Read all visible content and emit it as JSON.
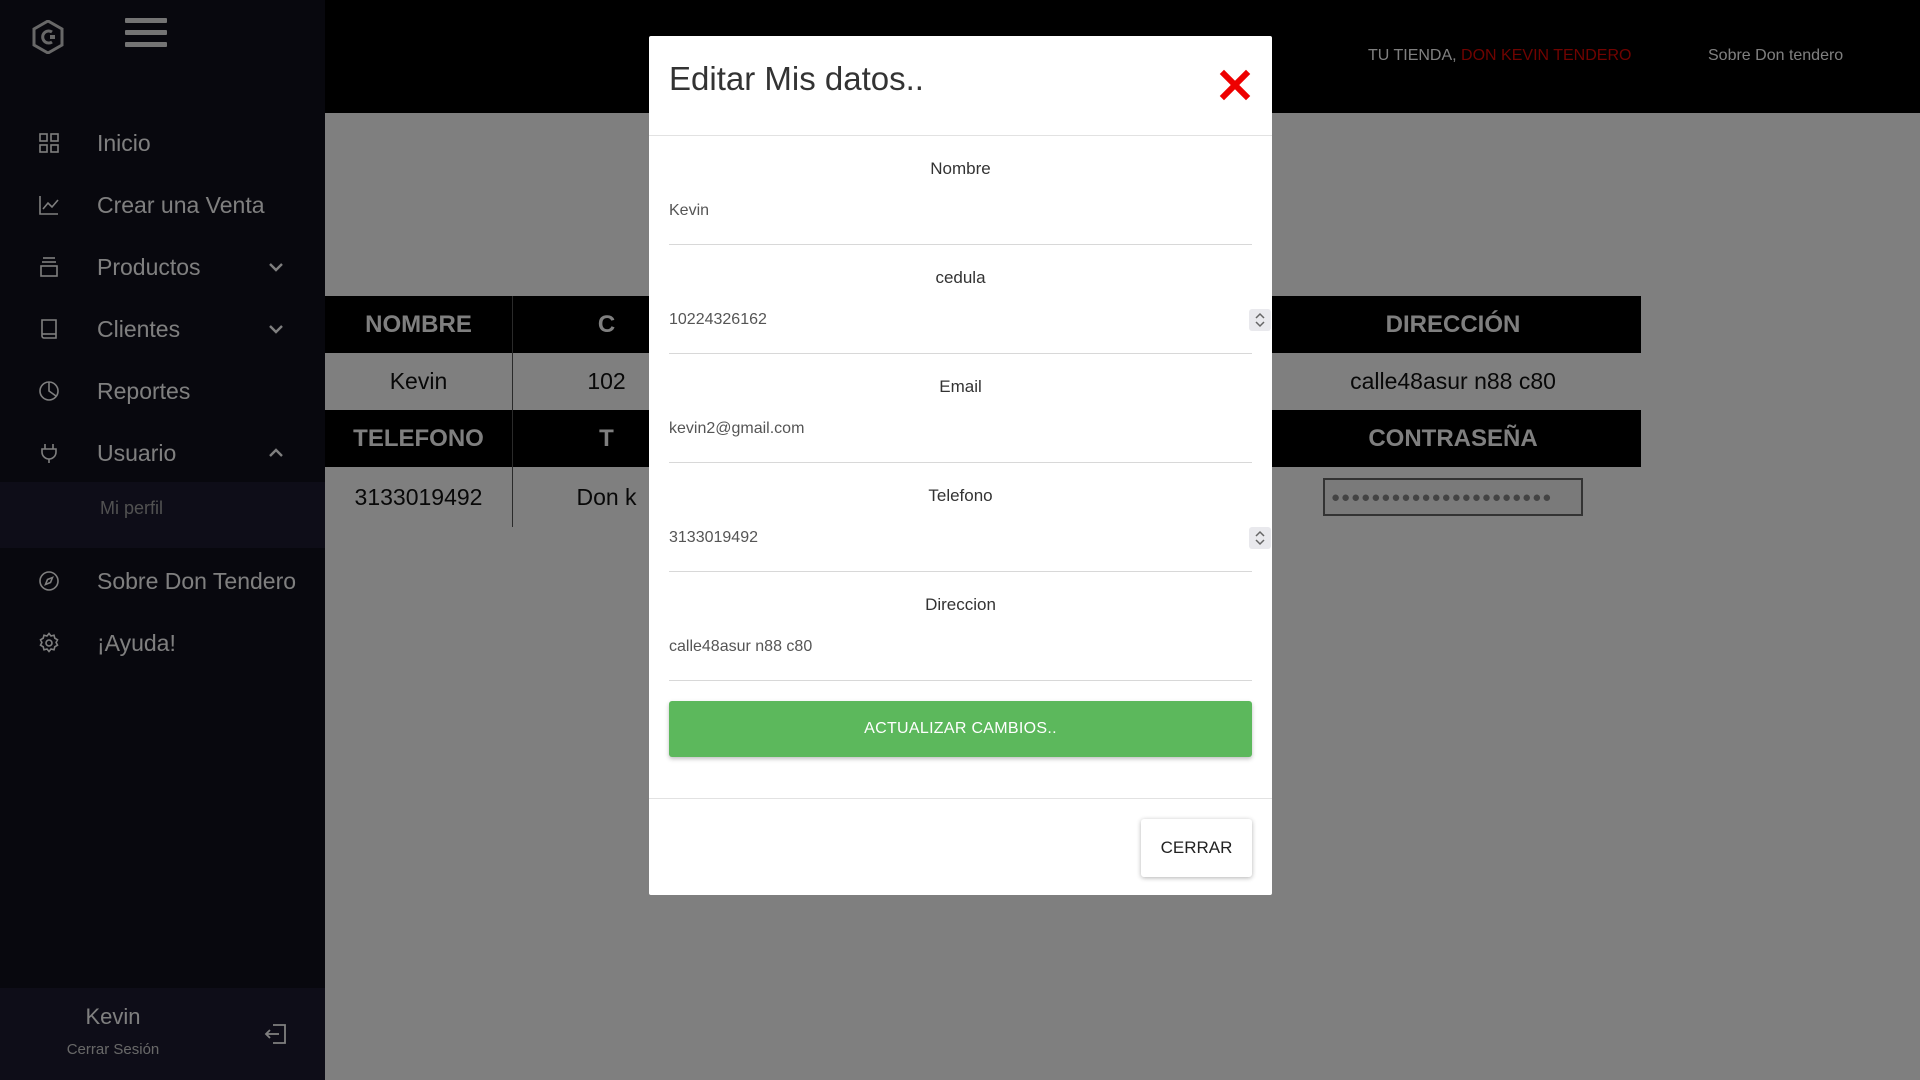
{
  "sidebar": {
    "items": [
      {
        "label": "Inicio",
        "icon": "grid-icon"
      },
      {
        "label": "Crear una Venta",
        "icon": "chart-line-icon"
      },
      {
        "label": "Productos",
        "icon": "stack-icon"
      },
      {
        "label": "Clientes",
        "icon": "book-icon"
      },
      {
        "label": "Reportes",
        "icon": "pie-chart-icon"
      },
      {
        "label": "Usuario",
        "icon": "plug-icon"
      },
      {
        "label": "Sobre Don Tendero",
        "icon": "compass-icon"
      },
      {
        "label": "¡Ayuda!",
        "icon": "gear-icon"
      }
    ],
    "submenu": {
      "label": "Mi perfil"
    },
    "profile": {
      "name": "Kevin",
      "logout_label": "Cerrar Sesión"
    }
  },
  "header": {
    "brand_prefix": "TU TIENDA, ",
    "brand_store": "DON KEVIN TENDERO",
    "about_link": "Sobre Don tendero"
  },
  "table": {
    "headers_row1": [
      "NOMBRE",
      "C",
      "",
      "",
      "",
      "DIRECCIÓN"
    ],
    "values_row1": [
      "Kevin",
      "102",
      "",
      "",
      "",
      "calle48asur n88 c80"
    ],
    "headers_row2": [
      "TELEFONO",
      "T",
      "",
      "",
      "",
      "CONTRASEÑA"
    ],
    "values_row2": [
      "3133019492",
      "Don k",
      "",
      "",
      "",
      ""
    ],
    "password_mask": "●●●●●●●●●●●●●●●●●●●●●●"
  },
  "modal": {
    "title": "Editar Mis datos..",
    "fields": [
      {
        "label": "Nombre",
        "value": "Kevin"
      },
      {
        "label": "cedula",
        "value": "10224326162"
      },
      {
        "label": "Email",
        "value": "kevin2@gmail.com"
      },
      {
        "label": "Telefono",
        "value": "3133019492"
      },
      {
        "label": "Direccion",
        "value": "calle48asur n88 c80"
      }
    ],
    "update_button": "ACTUALIZAR CAMBIOS..",
    "close_button": "CERRAR"
  },
  "colors": {
    "sidebar_bg": "#11101d",
    "accent_red": "#e10600",
    "update_green": "#5cb85c"
  }
}
